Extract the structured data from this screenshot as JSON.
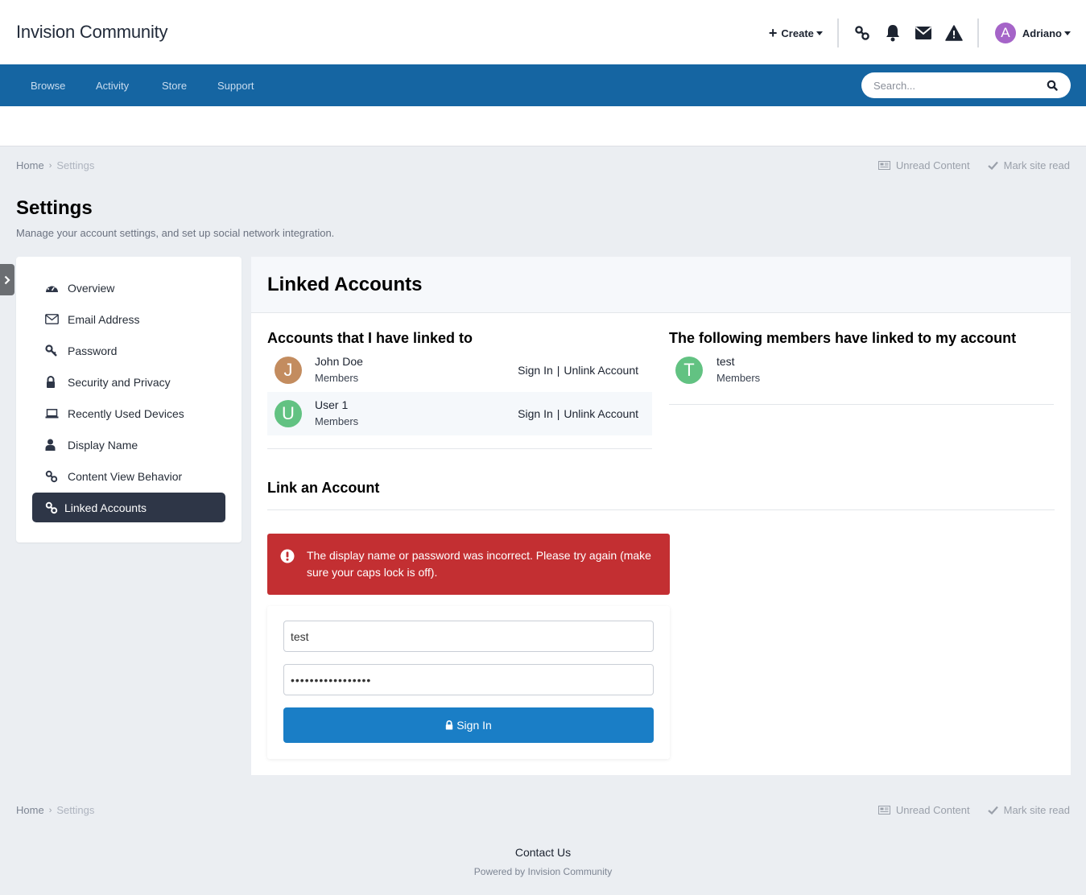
{
  "header": {
    "site_title": "Invision Community",
    "create_label": "Create",
    "icons": [
      "link-icon",
      "bell-icon",
      "envelope-icon",
      "warning-icon"
    ],
    "user": {
      "name": "Adriano",
      "initial": "A",
      "avatar_color": "#a564c8"
    }
  },
  "nav": {
    "items": [
      {
        "label": "Browse"
      },
      {
        "label": "Activity"
      },
      {
        "label": "Store"
      },
      {
        "label": "Support"
      }
    ],
    "search_placeholder": "Search...",
    "bar_color": "#1565a2"
  },
  "breadcrumb": {
    "home": "Home",
    "current": "Settings",
    "unread_content": "Unread Content",
    "mark_site_read": "Mark site read"
  },
  "page": {
    "title": "Settings",
    "description": "Manage your account settings, and set up social network integration."
  },
  "sidebar": {
    "items": [
      {
        "label": "Overview",
        "icon": "dashboard-icon",
        "active": false
      },
      {
        "label": "Email Address",
        "icon": "envelope-icon",
        "active": false
      },
      {
        "label": "Password",
        "icon": "key-icon",
        "active": false
      },
      {
        "label": "Security and Privacy",
        "icon": "lock-icon",
        "active": false
      },
      {
        "label": "Recently Used Devices",
        "icon": "laptop-icon",
        "active": false
      },
      {
        "label": "Display Name",
        "icon": "user-icon",
        "active": false
      },
      {
        "label": "Content View Behavior",
        "icon": "link-icon",
        "active": false
      },
      {
        "label": "Linked Accounts",
        "icon": "link-icon",
        "active": true
      }
    ]
  },
  "main": {
    "title": "Linked Accounts",
    "linked_to": {
      "title": "Accounts that I have linked to",
      "accounts": [
        {
          "name": "John Doe",
          "group": "Members",
          "initial": "J",
          "color": "#c38c5f",
          "sign_in": "Sign In",
          "unlink": "Unlink Account"
        },
        {
          "name": "User 1",
          "group": "Members",
          "initial": "U",
          "color": "#62c282",
          "sign_in": "Sign In",
          "unlink": "Unlink Account"
        }
      ]
    },
    "linked_from": {
      "title": "The following members have linked to my account",
      "accounts": [
        {
          "name": "test",
          "group": "Members",
          "initial": "T",
          "color": "#62c282"
        }
      ]
    },
    "link_account": {
      "title": "Link an Account",
      "error": "The display name or password was incorrect. Please try again (make sure your caps lock is off).",
      "error_color": "#c32f32",
      "username_value": "test",
      "password_value": "•••••••••••••••••",
      "sign_in_label": "Sign In"
    }
  },
  "footer": {
    "contact": "Contact Us",
    "powered_by": "Powered by Invision Community"
  }
}
